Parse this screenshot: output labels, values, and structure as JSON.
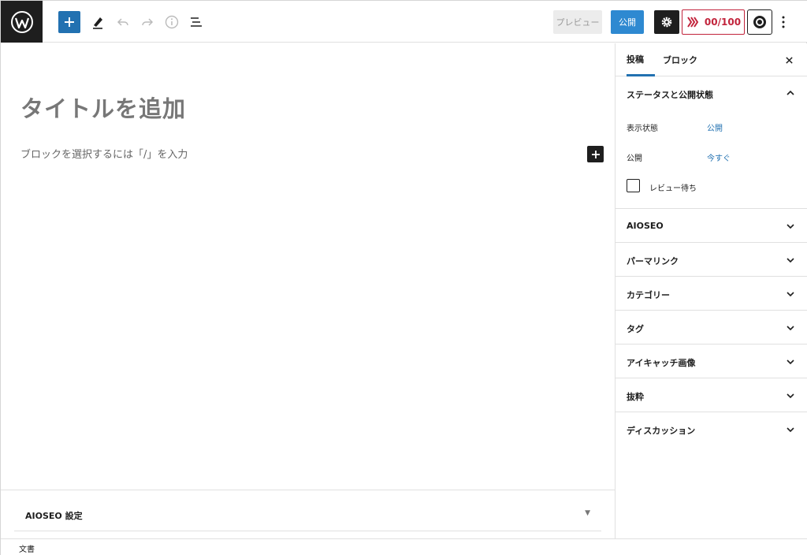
{
  "toolbar": {
    "preview_label": "プレビュー",
    "publish_label": "公開",
    "seo_score": "00/100",
    "icons": [
      "wordpress-logo",
      "plus-icon",
      "pencil-icon",
      "undo-icon",
      "redo-icon",
      "info-icon",
      "list-view-icon",
      "gear-icon",
      "aioseo-icon",
      "plugin-gear-icon",
      "more-vertical-icon"
    ]
  },
  "editor": {
    "title_placeholder": "タイトルを追加",
    "block_placeholder": "ブロックを選択するには「/」を入力"
  },
  "metabox": {
    "title": "AIOSEO 設定",
    "toggle": "▼"
  },
  "footer": {
    "breadcrumb": "文書"
  },
  "sidebar": {
    "tabs": [
      {
        "label": "投稿",
        "active": true
      },
      {
        "label": "ブロック",
        "active": false
      }
    ],
    "close": "×",
    "status_panel": {
      "title": "ステータスと公開状態",
      "visibility_label": "表示状態",
      "visibility_value": "公開",
      "publish_label": "公開",
      "publish_value": "今すぐ",
      "pending_label": "レビュー待ち"
    },
    "panels": [
      {
        "title": "AIOSEO"
      },
      {
        "title": "パーマリンク"
      },
      {
        "title": "カテゴリー"
      },
      {
        "title": "タグ"
      },
      {
        "title": "アイキャッチ画像"
      },
      {
        "title": "抜粋"
      },
      {
        "title": "ディスカッション"
      }
    ]
  },
  "colors": {
    "accent": "#2271b1",
    "publish": "#2e89d1",
    "dark": "#1e1e1e",
    "seo_red": "#c2243c"
  }
}
